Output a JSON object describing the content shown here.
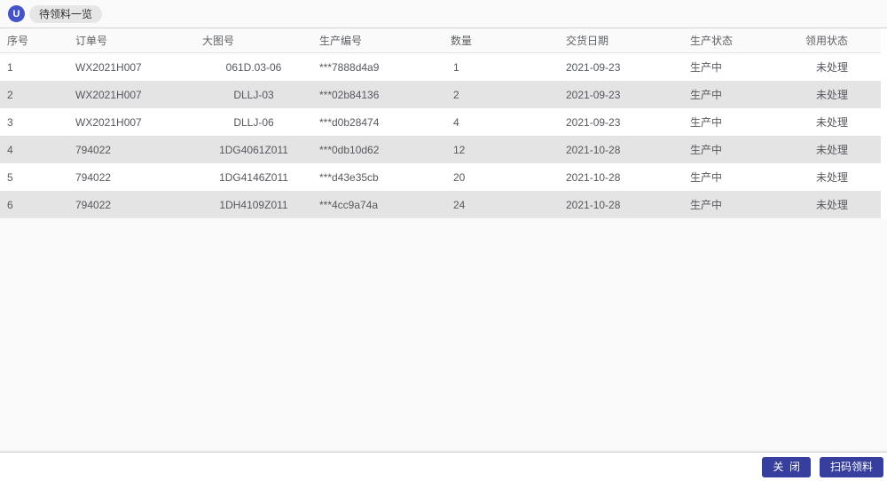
{
  "header": {
    "avatar_letter": "U",
    "tab_label": "待领料一览"
  },
  "table": {
    "columns": [
      "序号",
      "订单号",
      "大图号",
      "生产编号",
      "数量",
      "交货日期",
      "生产状态",
      "领用状态"
    ],
    "rows": [
      [
        "1",
        "WX2021H007",
        "061D.03-06",
        "***7888d4a9",
        "1",
        "2021-09-23",
        "生产中",
        "未处理"
      ],
      [
        "2",
        "WX2021H007",
        "DLLJ-03",
        "***02b84136",
        "2",
        "2021-09-23",
        "生产中",
        "未处理"
      ],
      [
        "3",
        "WX2021H007",
        "DLLJ-06",
        "***d0b28474",
        "4",
        "2021-09-23",
        "生产中",
        "未处理"
      ],
      [
        "4",
        "794022",
        "1DG4061Z011",
        "***0db10d62",
        "12",
        "2021-10-28",
        "生产中",
        "未处理"
      ],
      [
        "5",
        "794022",
        "1DG4146Z011",
        "***d43e35cb",
        "20",
        "2021-10-28",
        "生产中",
        "未处理"
      ],
      [
        "6",
        "794022",
        "1DH4109Z011",
        "***4cc9a74a",
        "24",
        "2021-10-28",
        "生产中",
        "未处理"
      ]
    ]
  },
  "footer": {
    "close_label": "关  闭",
    "scan_label": "扫码领料"
  },
  "colors": {
    "avatar_bg": "#4453c8",
    "button_bg": "#363f9d",
    "stripe_row_bg": "#e4e4e4",
    "chip_bg": "#e6e6e6",
    "page_bg": "#fafafa"
  }
}
